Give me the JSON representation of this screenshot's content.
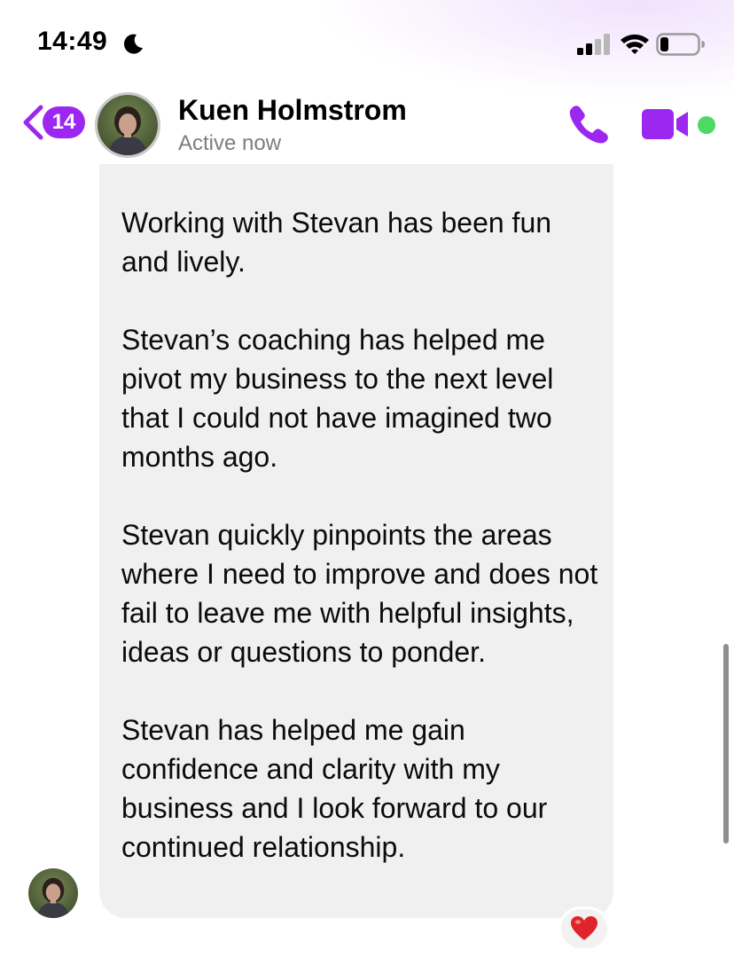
{
  "status_bar": {
    "time": "14:49",
    "moon_icon": "moon-icon",
    "signal_icon": "cellular-signal-icon",
    "wifi_icon": "wifi-icon",
    "battery_icon": "battery-icon",
    "battery_level": 0.22
  },
  "header": {
    "back_icon": "chevron-left-icon",
    "unread_count": "14",
    "contact_name": "Kuen Holmstrom",
    "contact_status": "Active now",
    "call_icon": "phone-icon",
    "video_icon": "video-camera-icon",
    "online_indicator": "online-dot"
  },
  "message": {
    "paragraphs": [
      "Working with Stevan has been fun and lively.",
      "Stevan’s coaching has helped me pivot my business to the next level that I could not have imagined two months ago.",
      "Stevan quickly pinpoints the areas where I need to improve and does not fail to leave me with helpful insights, ideas or questions to ponder.",
      "Stevan has helped me gain confidence and clarity with my business and I look forward to our continued relationship."
    ],
    "reaction": "❤️",
    "reaction_icon": "heart-icon"
  },
  "colors": {
    "accent": "#9c27f0",
    "online": "#4cd964",
    "bubble": "#f0f0f0",
    "secondary_text": "#7d7d82",
    "heart": "#e0242b"
  }
}
